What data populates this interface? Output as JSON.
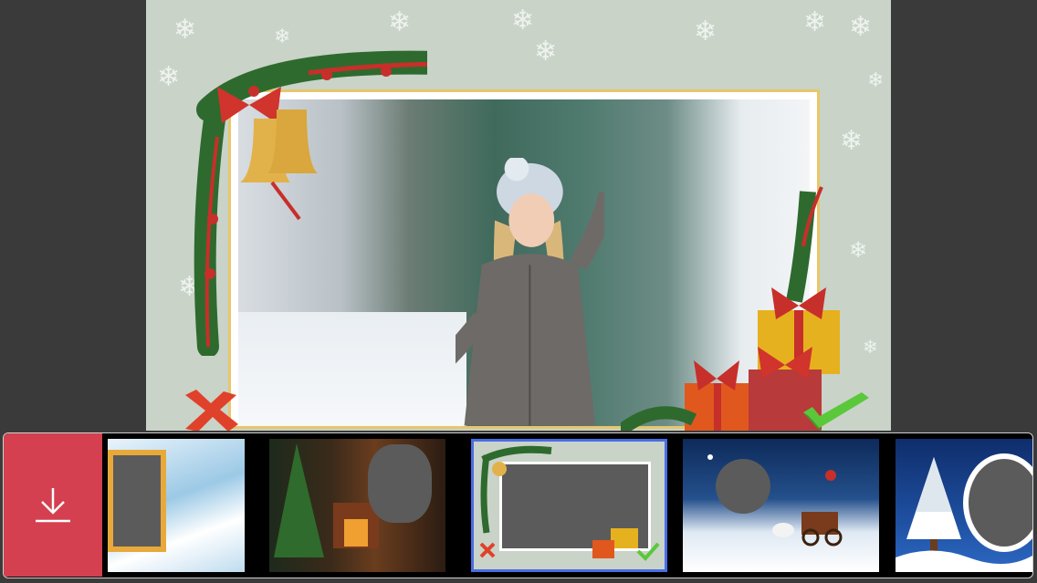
{
  "app": {
    "accent_color": "#d4404f",
    "selected_border_color": "#4a6de5"
  },
  "canvas": {
    "background": "#c9d3c8",
    "frame_border": "#e8c66a",
    "cancel_icon": "red-x-icon",
    "accept_icon": "green-check-icon"
  },
  "toolbar": {
    "download_icon": "download-icon"
  },
  "frames": [
    {
      "name": "snow-hills-frame",
      "selected": false
    },
    {
      "name": "fireplace-christmas-tree-frame",
      "selected": false
    },
    {
      "name": "holly-bells-gifts-frame",
      "selected": true
    },
    {
      "name": "santa-sleigh-night-frame",
      "selected": false
    },
    {
      "name": "snowy-tree-blue-frame",
      "selected": false
    }
  ]
}
